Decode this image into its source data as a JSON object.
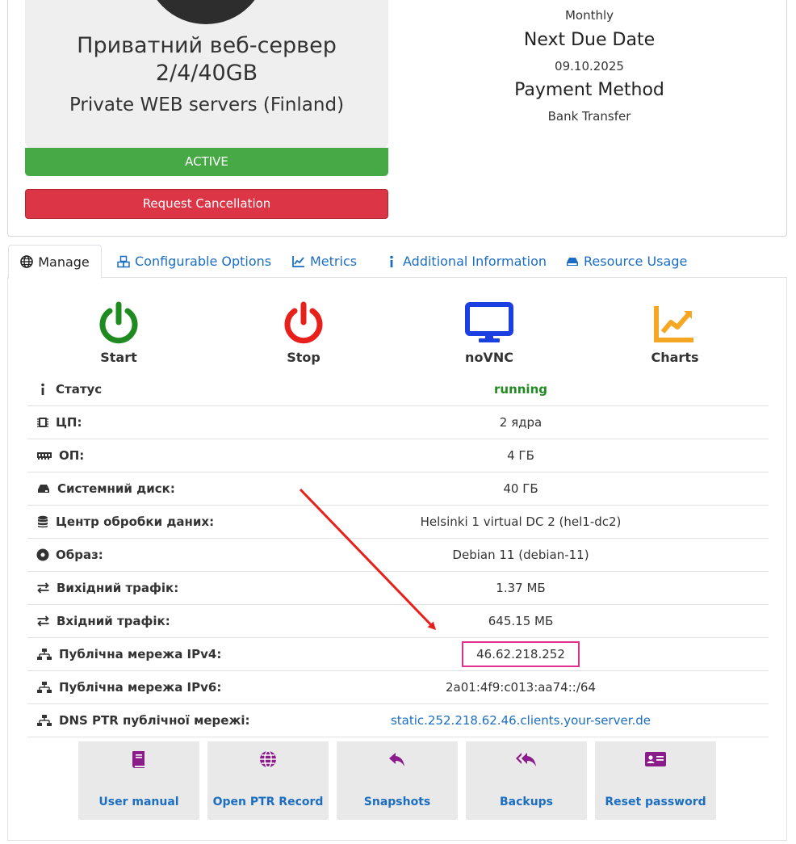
{
  "product": {
    "name_line1": "Приватний веб-сервер",
    "name_line2": "2/4/40GB",
    "group": "Private WEB servers (Finland)",
    "status": "ACTIVE",
    "cancel_label": "Request Cancellation"
  },
  "billing": {
    "cycle_value": "Monthly",
    "next_due_label": "Next Due Date",
    "next_due_value": "09.10.2025",
    "payment_label": "Payment Method",
    "payment_value": "Bank Transfer"
  },
  "tabs": [
    {
      "label": "Manage",
      "icon": "globe-icon"
    },
    {
      "label": "Configurable Options",
      "icon": "cubes-icon"
    },
    {
      "label": "Metrics",
      "icon": "line-chart-icon"
    },
    {
      "label": "Additional Information",
      "icon": "info-icon"
    },
    {
      "label": "Resource Usage",
      "icon": "hdd-icon"
    }
  ],
  "power": [
    {
      "label": "Start",
      "icon": "power-icon",
      "color": "#1f8a1f"
    },
    {
      "label": "Stop",
      "icon": "power-icon",
      "color": "#e8201c"
    },
    {
      "label": "noVNC",
      "icon": "monitor-icon",
      "color": "#1b3fe0"
    },
    {
      "label": "Charts",
      "icon": "area-chart-icon",
      "color": "#f5a623"
    }
  ],
  "details": [
    {
      "label": "Статус",
      "value": "running",
      "icon": "info-icon"
    },
    {
      "label": "ЦП:",
      "value": "2 ядра",
      "icon": "cpu-icon"
    },
    {
      "label": "ОП:",
      "value": "4 ГБ",
      "icon": "memory-icon"
    },
    {
      "label": "Системний диск:",
      "value": "40 ГБ",
      "icon": "hdd-icon"
    },
    {
      "label": "Центр обробки даних:",
      "value": "Helsinki 1 virtual DC 2 (hel1-dc2)",
      "icon": "database-icon"
    },
    {
      "label": "Образ:",
      "value": "Debian 11 (debian-11)",
      "icon": "disc-icon"
    },
    {
      "label": "Вихідний трафік:",
      "value": "1.37 МБ",
      "icon": "exchange-icon"
    },
    {
      "label": "Вхідний трафік:",
      "value": "645.15 МБ",
      "icon": "exchange-icon"
    },
    {
      "label": "Публічна мережа IPv4:",
      "value": "46.62.218.252",
      "icon": "network-icon"
    },
    {
      "label": "Публічна мережа IPv6:",
      "value": "2a01:4f9:c013:aa74::/64",
      "icon": "network-icon"
    },
    {
      "label": "DNS PTR публічної мережі:",
      "value": "static.252.218.62.46.clients.your-server.de",
      "icon": "network-icon"
    }
  ],
  "actions": [
    {
      "label": "User manual",
      "icon": "book-icon"
    },
    {
      "label": "Open PTR Record",
      "icon": "globe-icon"
    },
    {
      "label": "Snapshots",
      "icon": "reply-icon"
    },
    {
      "label": "Backups",
      "icon": "reply-all-icon"
    },
    {
      "label": "Reset password",
      "icon": "id-card-icon"
    }
  ],
  "colors": {
    "active": "#46a946",
    "danger": "#dc3545",
    "link": "#1b6ec2",
    "running": "#228b22",
    "action_icon": "#8b1a8b",
    "highlight": "#e0318f",
    "arrow": "#e8201c"
  }
}
